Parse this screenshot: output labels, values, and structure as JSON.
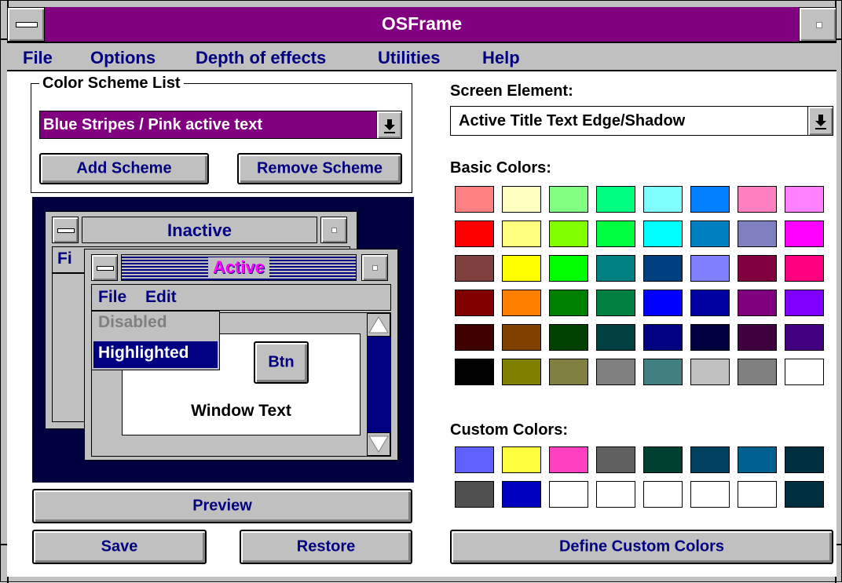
{
  "window": {
    "title": "OSFrame"
  },
  "menu": [
    "File",
    "Options",
    "Depth of effects",
    "Utilities",
    "Help"
  ],
  "scheme_group": {
    "label": "Color Scheme List",
    "selected": "Blue Stripes / Pink active text",
    "add_button": "Add Scheme",
    "remove_button": "Remove Scheme"
  },
  "preview": {
    "inactive_title": "Inactive",
    "inactive_menu_partial": "Fi",
    "active_title": "Active",
    "menu_file": "File",
    "menu_edit": "Edit",
    "disabled_item": "Disabled",
    "highlighted_item": "Highlighted",
    "button": "Btn",
    "window_text": "Window Text"
  },
  "buttons": {
    "preview": "Preview",
    "save": "Save",
    "restore": "Restore",
    "define_custom": "Define Custom Colors"
  },
  "screen_element": {
    "label": "Screen Element:",
    "selected": "Active Title Text Edge/Shadow"
  },
  "basic_colors": {
    "label": "Basic Colors:",
    "rows": [
      [
        "#ff8080",
        "#ffffc0",
        "#80ff80",
        "#00ff80",
        "#80ffff",
        "#0080ff",
        "#ff80c0",
        "#ff80ff"
      ],
      [
        "#ff0000",
        "#ffff80",
        "#80ff00",
        "#00ff40",
        "#00ffff",
        "#0080c0",
        "#8080c0",
        "#ff00ff"
      ],
      [
        "#804040",
        "#ffff00",
        "#00ff00",
        "#008080",
        "#004080",
        "#8080ff",
        "#800040",
        "#ff0080"
      ],
      [
        "#800000",
        "#ff8000",
        "#008000",
        "#008040",
        "#0000ff",
        "#0000a0",
        "#800080",
        "#8000ff"
      ],
      [
        "#400000",
        "#804000",
        "#004000",
        "#004040",
        "#000080",
        "#000040",
        "#400040",
        "#400080"
      ],
      [
        "#000000",
        "#808000",
        "#808040",
        "#808080",
        "#408080",
        "#c0c0c0",
        "#808080",
        "#ffffff"
      ]
    ]
  },
  "custom_colors": {
    "label": "Custom Colors:",
    "rows": [
      [
        "#6060ff",
        "#ffff40",
        "#ff40c0",
        "#606060",
        "#004030",
        "#004060",
        "#006090",
        "#003040"
      ],
      [
        "#505050",
        "#0000c0",
        "#ffffff",
        "#ffffff",
        "#ffffff",
        "#ffffff",
        "#ffffff",
        "#003040"
      ]
    ]
  }
}
